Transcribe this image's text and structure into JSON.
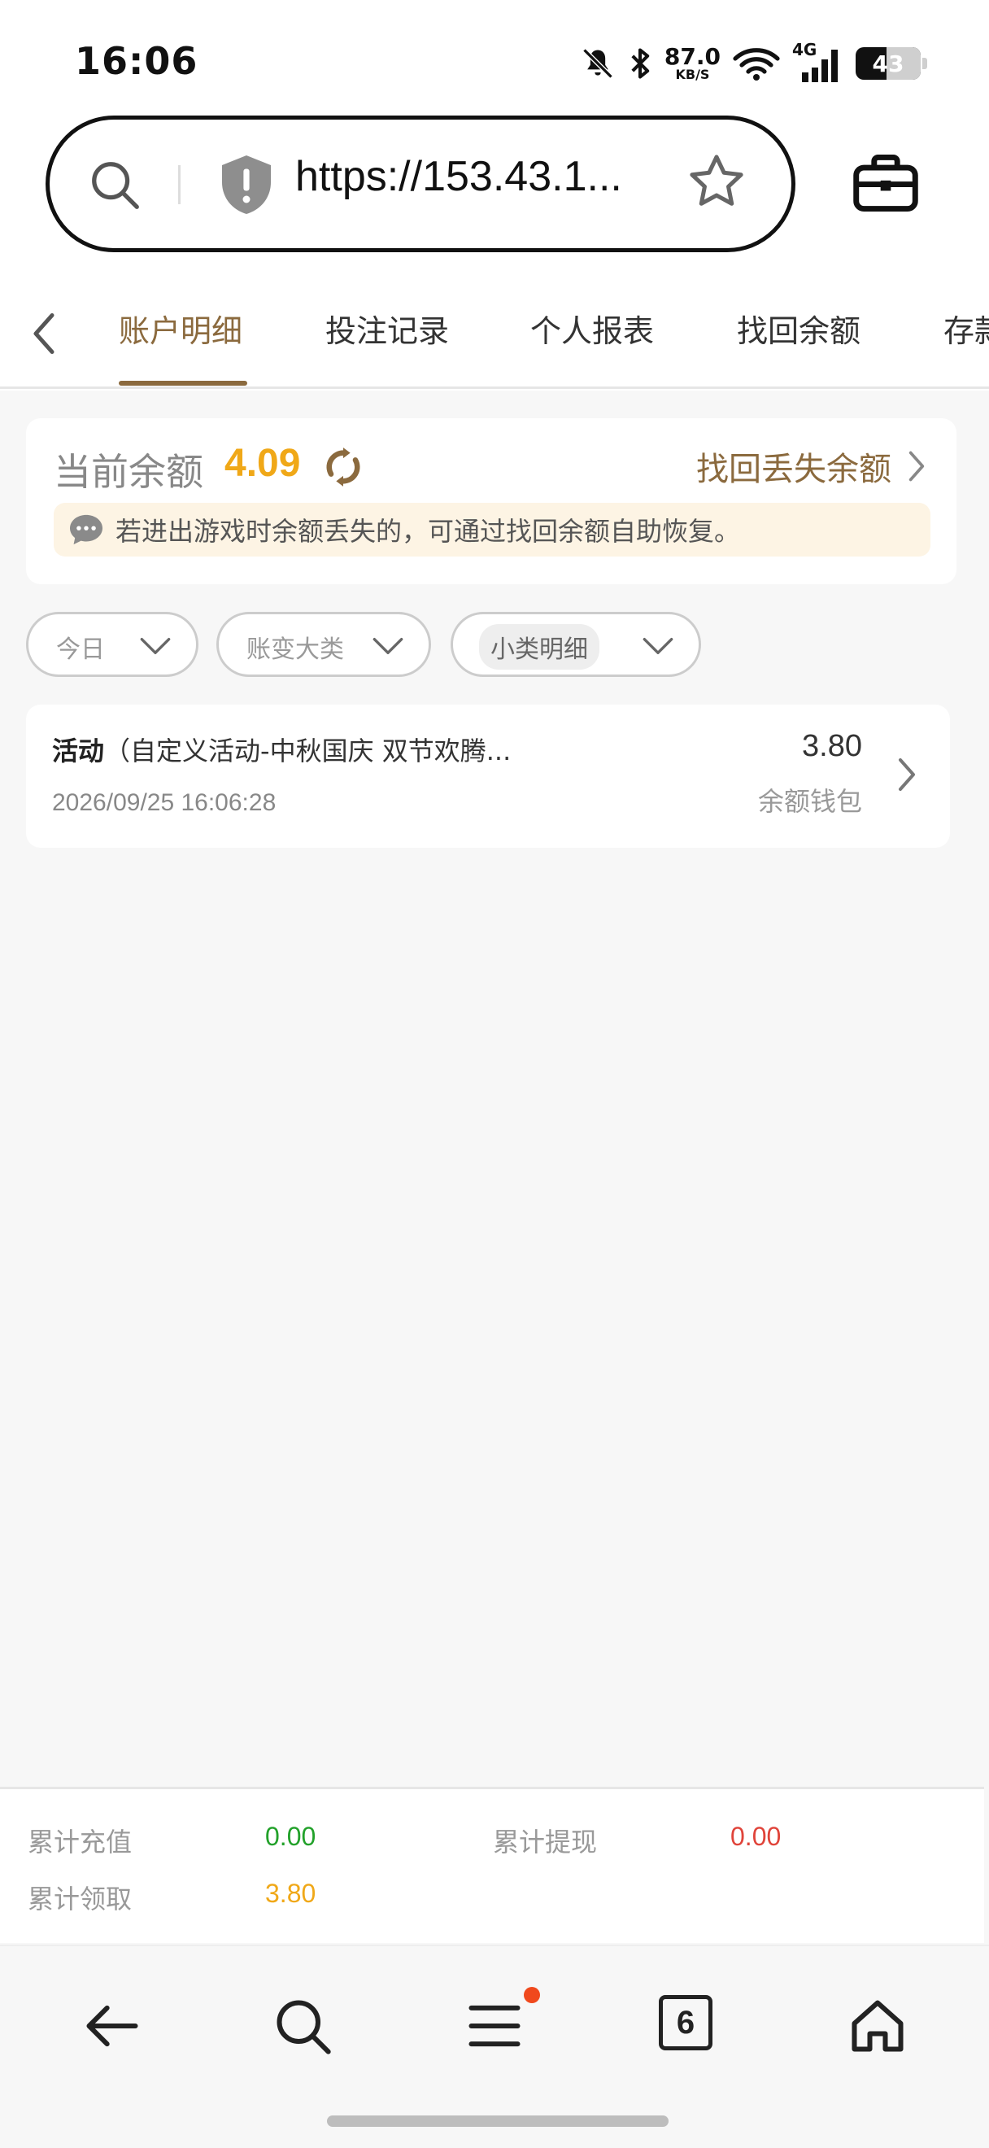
{
  "status_bar": {
    "time": "16:06",
    "net_speed_value": "87.0",
    "net_speed_unit": "KB/S",
    "network_type": "4G",
    "battery_level": "43"
  },
  "browser": {
    "url": "https://153.43.1...",
    "icons": [
      "search-icon",
      "shield-icon",
      "star-icon",
      "toolbox-icon"
    ]
  },
  "tabs": [
    {
      "label": "账户明细",
      "active": true
    },
    {
      "label": "投注记录",
      "active": false
    },
    {
      "label": "个人报表",
      "active": false
    },
    {
      "label": "找回余额",
      "active": false
    },
    {
      "label": "存款",
      "active": false
    }
  ],
  "balance": {
    "label": "当前余额",
    "value": "4.09",
    "recover_link": "找回丢失余额",
    "notice": "若进出游戏时余额丢失的，可通过找回余额自助恢复。"
  },
  "filters": [
    {
      "label": "今日"
    },
    {
      "label": "账变大类"
    },
    {
      "label": "小类明细"
    }
  ],
  "records": [
    {
      "type": "活动",
      "desc": "（自定义活动-中秋国庆 双节欢腾...",
      "date": "2026/09/25 16:06:28",
      "amount": "3.80",
      "wallet": "余额钱包"
    }
  ],
  "summary": {
    "recharge_label": "累计充值",
    "recharge_value": "0.00",
    "withdraw_label": "累计提现",
    "withdraw_value": "0.00",
    "claim_label": "累计领取",
    "claim_value": "3.80"
  },
  "bottom_nav": {
    "tab_count": "6"
  },
  "colors": {
    "accent": "#8b6a3e",
    "balance": "#f0a818",
    "recharge": "#22a12a",
    "withdraw": "#e0443a",
    "claim": "#f0a818"
  }
}
